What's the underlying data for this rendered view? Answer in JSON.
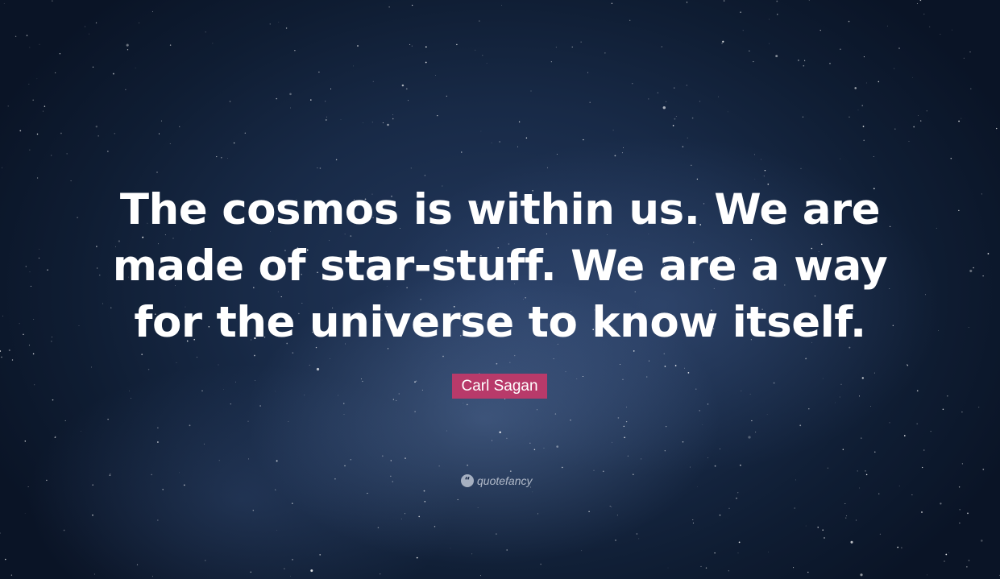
{
  "quote": {
    "text": "The cosmos is within us. We are made of star-stuff. We are a way for the universe to know itself."
  },
  "author": {
    "name": "Carl Sagan",
    "badge_color": "#b83a6a"
  },
  "watermark": {
    "icon": "quote-marks-icon",
    "text": "quotefancy"
  },
  "background": {
    "theme": "starry night sky",
    "base_color": "#182a47"
  }
}
